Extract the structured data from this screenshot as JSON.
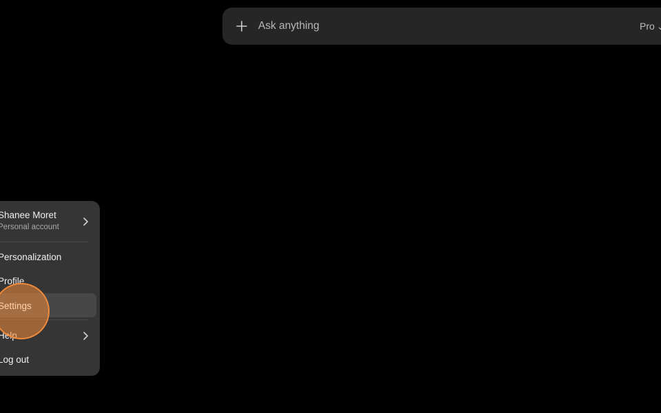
{
  "composer": {
    "placeholder": "Ask anything",
    "model_label": "Pro",
    "plus_icon": "plus-icon",
    "caret_icon": "chevron-down-icon"
  },
  "account_menu": {
    "user_name": "Shanee Moret",
    "account_type": "Personal account",
    "items": [
      {
        "label": "Personalization",
        "icon": ""
      },
      {
        "label": "Profile",
        "icon": ""
      },
      {
        "label": "Settings",
        "icon": "",
        "state": "highlighted"
      },
      {
        "label": "Help",
        "icon": "chevron-right-icon"
      },
      {
        "label": "Log out",
        "icon": ""
      }
    ]
  },
  "colors": {
    "background": "#000000",
    "composer_bg": "#262626",
    "menu_bg": "#353535",
    "menu_hover_bg": "#474747",
    "click_highlight": "#f08a3a"
  }
}
